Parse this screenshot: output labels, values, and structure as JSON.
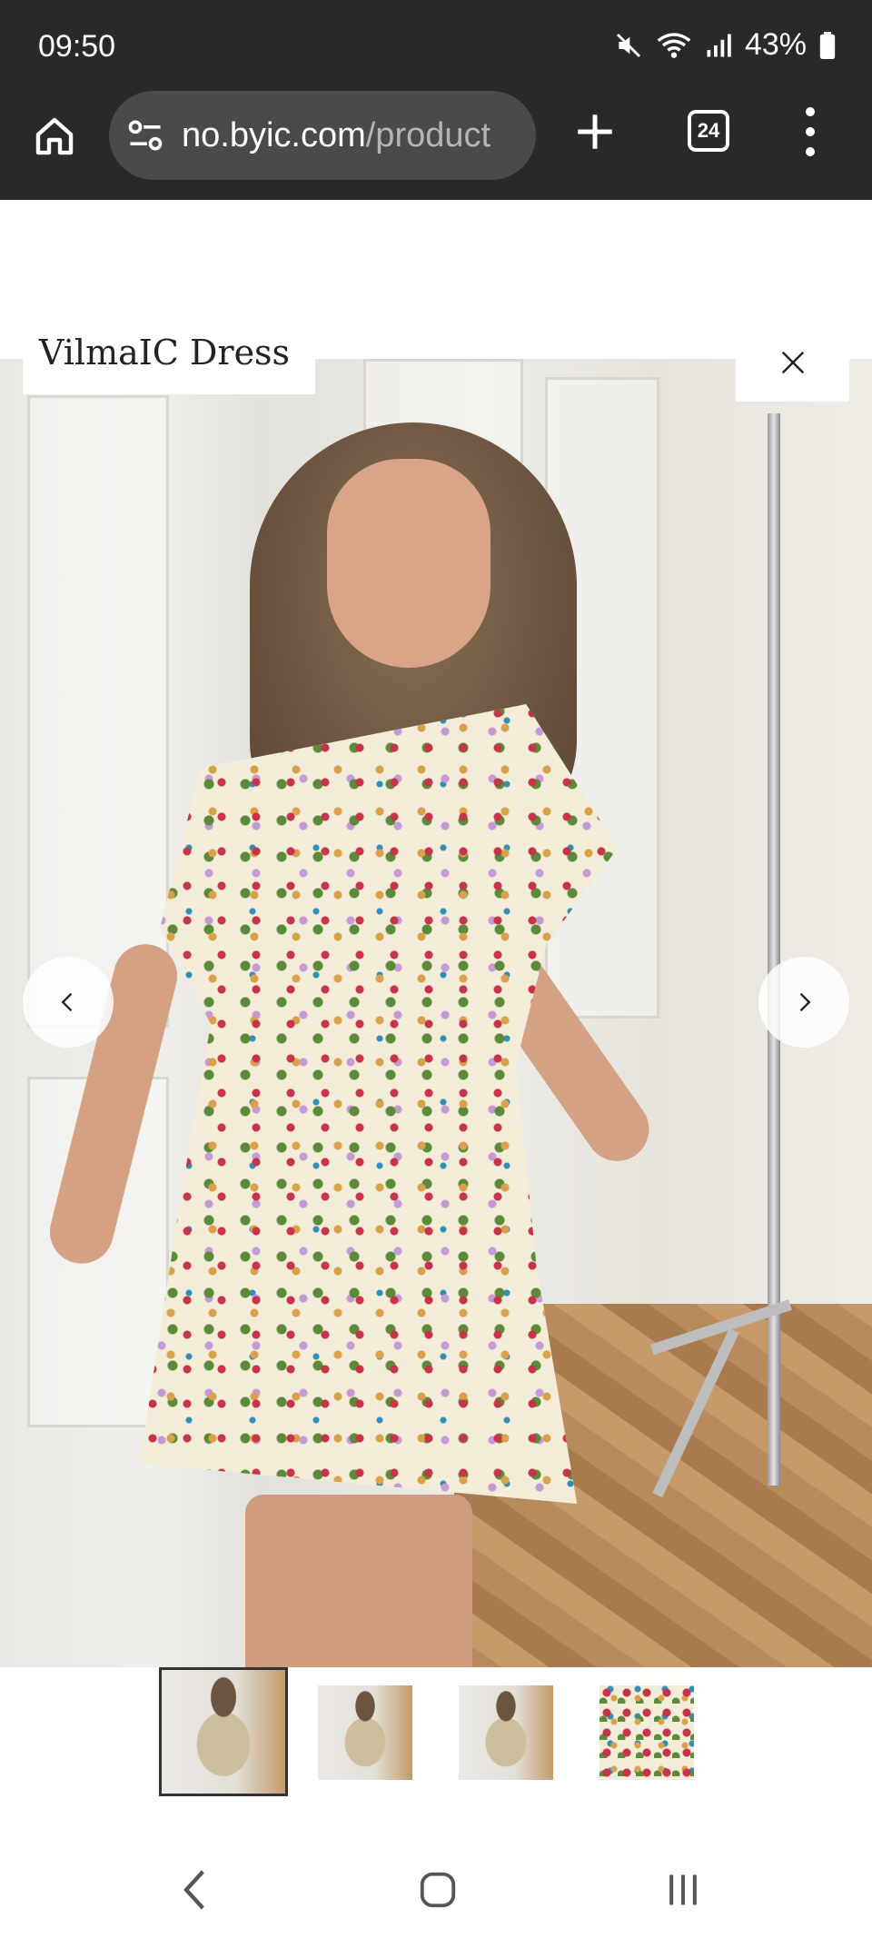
{
  "status_bar": {
    "time": "09:50",
    "battery": "43%",
    "icons": [
      "mute-icon",
      "wifi-icon",
      "signal-icon",
      "battery-icon"
    ]
  },
  "browser": {
    "url_host": "no.byic.com",
    "url_path": "/product",
    "tab_count": "24",
    "icons": [
      "home-icon",
      "site-settings-icon",
      "plus-icon",
      "tabs-icon",
      "more-icon"
    ]
  },
  "product": {
    "title": "VilmaIC Dress",
    "photo_alt": "Model wearing floral tiered dress",
    "thumbnails": [
      {
        "name": "thumbnail-1",
        "active": true,
        "kind": "photo"
      },
      {
        "name": "thumbnail-2",
        "active": false,
        "kind": "photo"
      },
      {
        "name": "thumbnail-3",
        "active": false,
        "kind": "photo"
      },
      {
        "name": "thumbnail-4",
        "active": false,
        "kind": "print"
      }
    ]
  },
  "colors": {
    "chrome_bg": "#292929",
    "url_bar_bg": "#4a4a4a",
    "url_path": "#b5b5b5"
  }
}
